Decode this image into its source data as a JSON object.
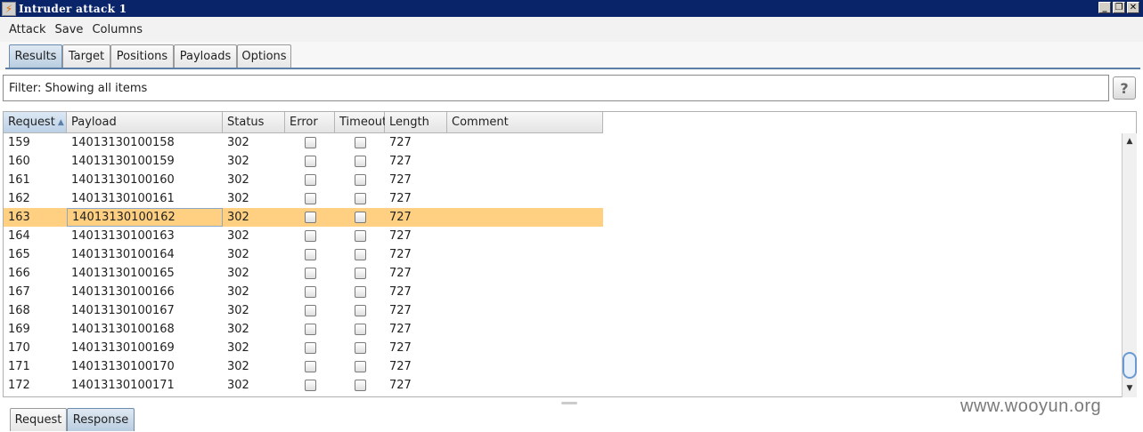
{
  "window": {
    "title": "Intruder attack 1",
    "buttons": [
      "_",
      "❐",
      "✕"
    ]
  },
  "menu": [
    "Attack",
    "Save",
    "Columns"
  ],
  "tabs": [
    "Results",
    "Target",
    "Positions",
    "Payloads",
    "Options"
  ],
  "active_tab": "Results",
  "filter": {
    "text": "Filter:  Showing all items",
    "help": "?"
  },
  "table": {
    "columns": [
      "Request",
      "Payload",
      "Status",
      "Error",
      "Timeout",
      "Length",
      "Comment"
    ],
    "sort_indicator": "▲",
    "rows": [
      {
        "request": "159",
        "payload": "14013130100158",
        "status": "302",
        "length": "727"
      },
      {
        "request": "160",
        "payload": "14013130100159",
        "status": "302",
        "length": "727"
      },
      {
        "request": "161",
        "payload": "14013130100160",
        "status": "302",
        "length": "727"
      },
      {
        "request": "162",
        "payload": "14013130100161",
        "status": "302",
        "length": "727"
      },
      {
        "request": "163",
        "payload": "14013130100162",
        "status": "302",
        "length": "727",
        "selected": true
      },
      {
        "request": "164",
        "payload": "14013130100163",
        "status": "302",
        "length": "727"
      },
      {
        "request": "165",
        "payload": "14013130100164",
        "status": "302",
        "length": "727"
      },
      {
        "request": "166",
        "payload": "14013130100165",
        "status": "302",
        "length": "727"
      },
      {
        "request": "167",
        "payload": "14013130100166",
        "status": "302",
        "length": "727"
      },
      {
        "request": "168",
        "payload": "14013130100167",
        "status": "302",
        "length": "727"
      },
      {
        "request": "169",
        "payload": "14013130100168",
        "status": "302",
        "length": "727"
      },
      {
        "request": "170",
        "payload": "14013130100169",
        "status": "302",
        "length": "727"
      },
      {
        "request": "171",
        "payload": "14013130100170",
        "status": "302",
        "length": "727"
      },
      {
        "request": "172",
        "payload": "14013130100171",
        "status": "302",
        "length": "727"
      }
    ]
  },
  "bottom_tabs": [
    "Request",
    "Response"
  ],
  "active_bottom_tab": "Response",
  "watermark": "www.wooyun.org",
  "colors": {
    "title_bar": "#0a246a",
    "selected_row": "#ffd081",
    "accent": "#5b7fa6"
  }
}
